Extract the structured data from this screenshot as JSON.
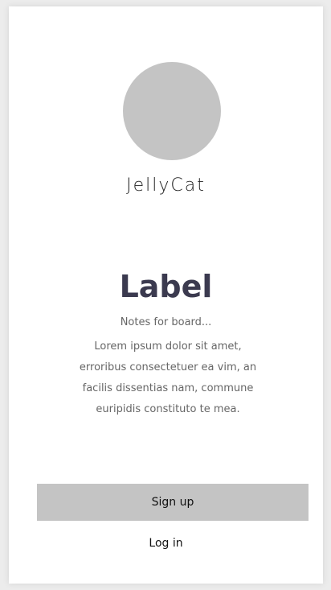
{
  "profile": {
    "app_name": "JellyCat",
    "avatar_color": "#c4c4c4"
  },
  "content": {
    "label": "Label",
    "notes": "Notes for board...",
    "description": "Lorem ipsum dolor sit amet, erroribus consectetuer ea vim, an facilis dissentias nam, commune euripidis constituto te mea."
  },
  "actions": {
    "signup_label": "Sign up",
    "login_label": "Log in"
  },
  "colors": {
    "title": "#3b3a4f",
    "button_bg": "#c4c4c4",
    "body_text": "#666666"
  }
}
